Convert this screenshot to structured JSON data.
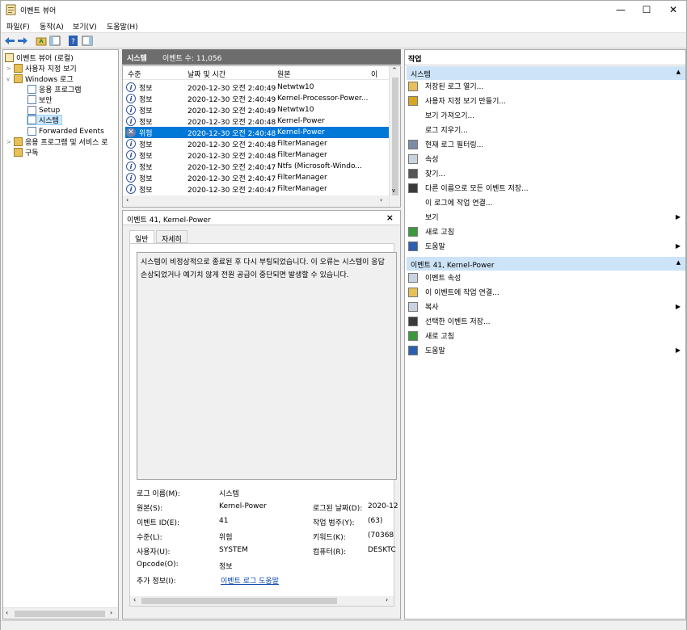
{
  "window": {
    "title": "이벤트 뷰어",
    "minimize": "—",
    "maximize": "☐",
    "close": "✕"
  },
  "menu": [
    "파일(F)",
    "동작(A)",
    "보기(V)",
    "도움말(H)"
  ],
  "tree": {
    "root": "이벤트 뷰어 (로컬)",
    "custom_views": "사용자 지정 보기",
    "windows_logs": "Windows 로그",
    "app": "응용 프로그램",
    "security": "보안",
    "setup": "Setup",
    "system": "시스템",
    "forwarded": "Forwarded Events",
    "apps_services": "응용 프로그램 및 서비스 로",
    "subscriptions": "구독"
  },
  "center": {
    "header_title": "시스템",
    "header_count": "이벤트 수: 11,056",
    "columns": {
      "level": "수준",
      "date": "날짜 및 시간",
      "source": "원본",
      "extra": "이"
    },
    "rows": [
      {
        "level": "정보",
        "date": "2020-12-30 오전 2:40:49",
        "source": "Netwtw10"
      },
      {
        "level": "정보",
        "date": "2020-12-30 오전 2:40:49",
        "source": "Kernel-Processor-Power..."
      },
      {
        "level": "정보",
        "date": "2020-12-30 오전 2:40:49",
        "source": "Netwtw10"
      },
      {
        "level": "정보",
        "date": "2020-12-30 오전 2:40:48",
        "source": "Kernel-Power"
      },
      {
        "level": "위험",
        "date": "2020-12-30 오전 2:40:48",
        "source": "Kernel-Power"
      },
      {
        "level": "정보",
        "date": "2020-12-30 오전 2:40:48",
        "source": "FilterManager"
      },
      {
        "level": "정보",
        "date": "2020-12-30 오전 2:40:48",
        "source": "FilterManager"
      },
      {
        "level": "정보",
        "date": "2020-12-30 오전 2:40:47",
        "source": "Ntfs (Microsoft-Windo..."
      },
      {
        "level": "정보",
        "date": "2020-12-30 오전 2:40:47",
        "source": "FilterManager"
      },
      {
        "level": "정보",
        "date": "2020-12-30 오전 2:40:47",
        "source": "FilterManager"
      }
    ]
  },
  "detail": {
    "title": "이벤트 41, Kernel-Power",
    "close": "×",
    "tabs": [
      "일반",
      "자세히"
    ],
    "description_line1": "시스템이 비정상적으로 종료된 후 다시 부팅되었습니다. 이 오류는 시스템이 응답",
    "description_line2": "손상되었거나 예기치 않게 전원 공급이 중단되면 발생할 수 있습니다.",
    "fields": {
      "log_name_label": "로그 이름(M):",
      "log_name": "시스템",
      "source_label": "원본(S):",
      "source": "Kernel-Power",
      "logged_label": "로그된 날짜(D):",
      "logged": "2020-12",
      "event_id_label": "이벤트 ID(E):",
      "event_id": "41",
      "task_label": "작업 범주(Y):",
      "task": "(63)",
      "level_label": "수준(L):",
      "level": "위험",
      "keywords_label": "키워드(K):",
      "keywords": "(70368",
      "user_label": "사용자(U):",
      "user": "SYSTEM",
      "computer_label": "컴퓨터(R):",
      "computer": "DESKTC",
      "opcode_label": "Opcode(O):",
      "opcode": "정보",
      "more_label": "추가 정보(I):",
      "more_link": "이벤트 로그 도움말"
    }
  },
  "actions": {
    "header": "작업",
    "section1": "시스템",
    "items1": [
      "저장된 로그 열기...",
      "사용자 지정 보기 만들기...",
      "보기 가져오기...",
      "로그 지우기...",
      "현재 로그 필터링...",
      "속성",
      "찾기...",
      "다른 이름으로 모든 이벤트 저장...",
      "이 로그에 작업 연결...",
      "보기",
      "새로 고침",
      "도움말"
    ],
    "section2": "이벤트 41, Kernel-Power",
    "items2": [
      "이벤트 속성",
      "이 이벤트에 작업 연결...",
      "복사",
      "선택한 이벤트 저장...",
      "새로 고침",
      "도움말"
    ]
  }
}
